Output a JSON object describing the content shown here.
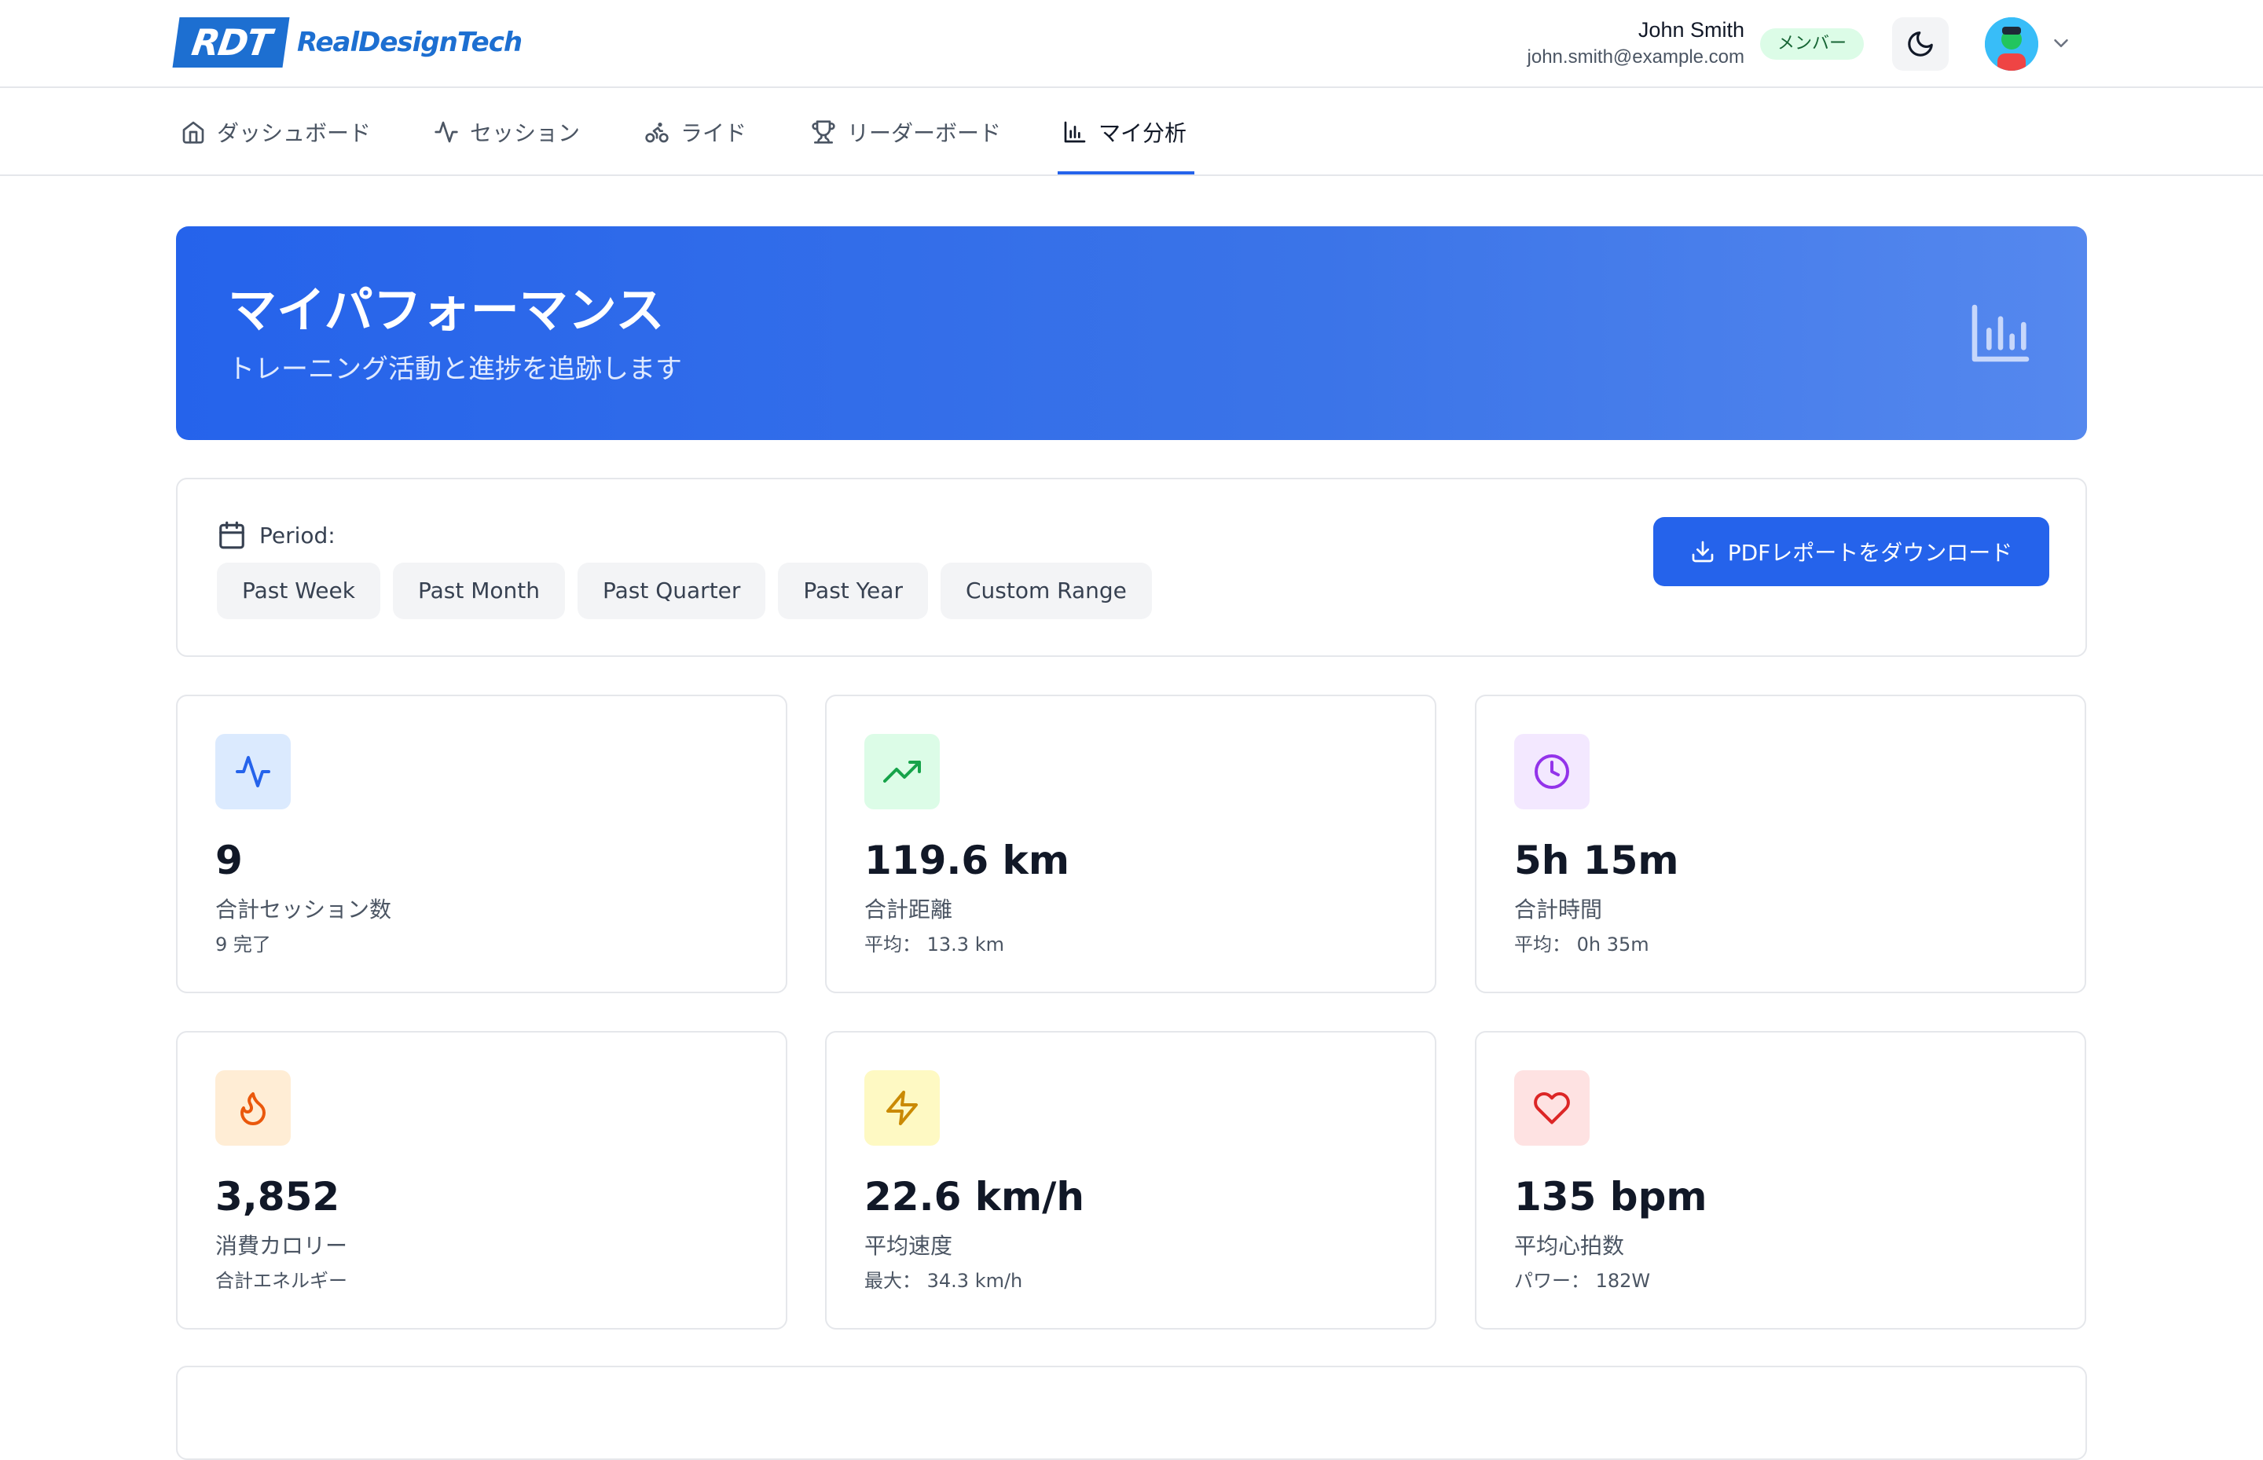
{
  "brand": {
    "mark": "RDT",
    "name": "RealDesignTech",
    "color": "#1d6fd1"
  },
  "user": {
    "name": "John Smith",
    "email": "john.smith@example.com",
    "role": "メンバー"
  },
  "nav": {
    "items": [
      {
        "label": "ダッシュボード",
        "icon": "home-icon"
      },
      {
        "label": "セッション",
        "icon": "activity-icon"
      },
      {
        "label": "ライド",
        "icon": "bike-icon"
      },
      {
        "label": "リーダーボード",
        "icon": "trophy-icon"
      },
      {
        "label": "マイ分析",
        "icon": "bar-chart-icon",
        "active": true
      }
    ]
  },
  "hero": {
    "title": "マイパフォーマンス",
    "subtitle": "トレーニング活動と進捗を追跡します",
    "icon": "bar-chart-icon"
  },
  "filter": {
    "period_label": "Period:",
    "options": [
      "Past Week",
      "Past Month",
      "Past Quarter",
      "Past Year",
      "Custom Range"
    ],
    "download_label": "PDFレポートをダウンロード"
  },
  "stats": [
    {
      "value": "9",
      "label": "合計セッション数",
      "sub": "9 完了",
      "icon": "activity-icon",
      "bg": "#dbeafe",
      "fg": "#2563eb"
    },
    {
      "value": "119.6 km",
      "label": "合計距離",
      "sub": "平均： 13.3 km",
      "icon": "trending-up-icon",
      "bg": "#dcfce7",
      "fg": "#16a34a"
    },
    {
      "value": "5h 15m",
      "label": "合計時間",
      "sub": "平均： 0h 35m",
      "icon": "clock-icon",
      "bg": "#f3e8ff",
      "fg": "#9333ea"
    },
    {
      "value": "3,852",
      "label": "消費カロリー",
      "sub": "合計エネルギー",
      "icon": "flame-icon",
      "bg": "#ffedd5",
      "fg": "#ea580c"
    },
    {
      "value": "22.6 km/h",
      "label": "平均速度",
      "sub": "最大： 34.3 km/h",
      "icon": "zap-icon",
      "bg": "#fef9c3",
      "fg": "#ca8a04"
    },
    {
      "value": "135 bpm",
      "label": "平均心拍数",
      "sub": "パワー： 182W",
      "icon": "heart-icon",
      "bg": "#fee2e2",
      "fg": "#dc2626"
    }
  ],
  "colors": {
    "accent": "#2563eb",
    "border": "#e5e7eb",
    "chip_bg": "#f3f4f6"
  }
}
